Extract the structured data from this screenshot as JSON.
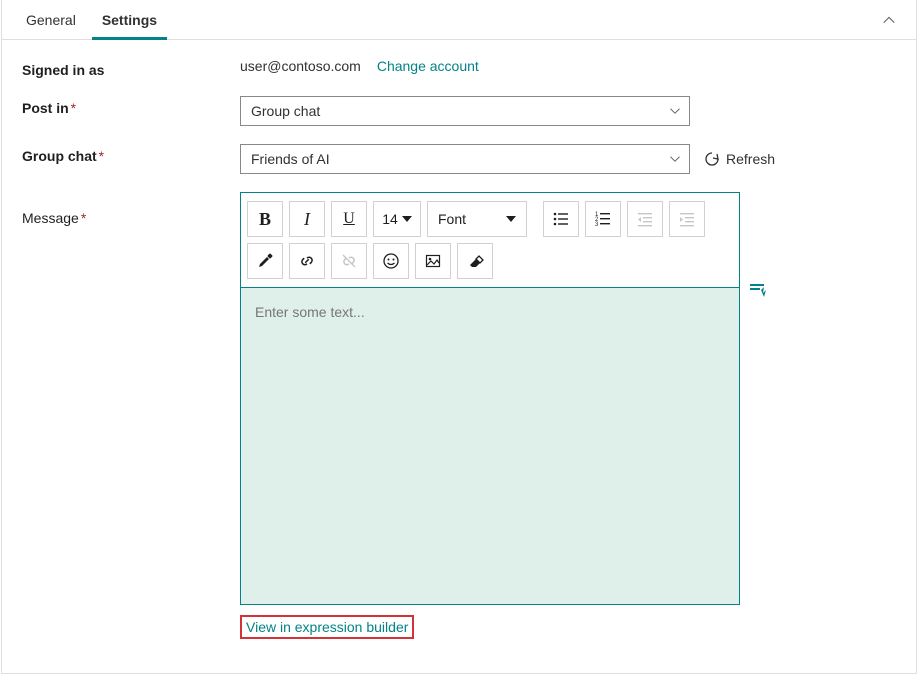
{
  "tabs": {
    "general": "General",
    "settings": "Settings"
  },
  "labels": {
    "signed_in_as": "Signed in as",
    "post_in": "Post in",
    "group_chat": "Group chat",
    "message": "Message"
  },
  "signed_in": {
    "email": "user@contoso.com",
    "change": "Change account"
  },
  "post_in": {
    "value": "Group chat"
  },
  "group_chat": {
    "value": "Friends of AI",
    "refresh": "Refresh"
  },
  "editor": {
    "placeholder": "Enter some text...",
    "font_size": "14",
    "font_label": "Font"
  },
  "footer": {
    "exp_link": "View in expression builder"
  }
}
